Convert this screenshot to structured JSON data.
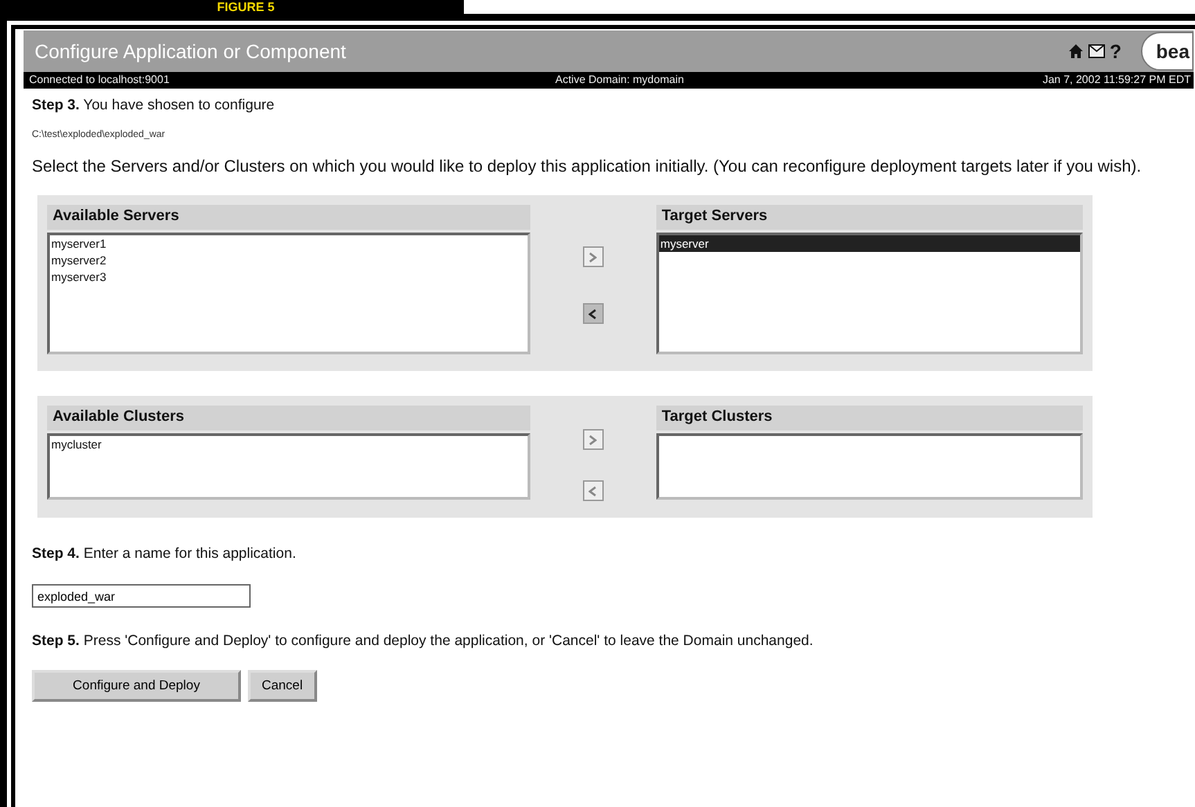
{
  "figure_label": "FIGURE 5",
  "window": {
    "title": "Configure Application or Component",
    "toolbar": [
      {
        "kind": "home"
      },
      {
        "kind": "mail"
      },
      {
        "kind": "help",
        "glyph": "?"
      }
    ],
    "logo": "bea"
  },
  "status_bar": {
    "connection": "Connected to localhost:9001",
    "domain": "Active Domain: mydomain",
    "time": "Jan 7, 2002 11:59:27 PM EDT"
  },
  "step3": {
    "text": "**Step 3.** You have shosen to configure",
    "path": "C:\\test\\exploded\\exploded_war"
  },
  "instructions": "Select the Servers and/or Clusters on which you would like to deploy this application initially. (You can reconfigure deployment targets later if you wish).",
  "panels": [
    {
      "available": {
        "heading": "Available Servers",
        "items": [
          {
            "label": "myserver1",
            "selected": false
          },
          {
            "label": "myserver2",
            "selected": false
          },
          {
            "label": "myserver3",
            "selected": false
          }
        ]
      },
      "moves": [
        {
          "kind": "add",
          "disabled": true
        },
        {
          "kind": "remove",
          "disabled": false
        }
      ],
      "target": {
        "heading": "Target Servers",
        "items": [
          {
            "label": "myserver",
            "selected": true
          }
        ]
      }
    },
    {
      "available": {
        "heading": "Available Clusters",
        "items": [
          {
            "label": "mycluster",
            "selected": false
          }
        ]
      },
      "moves": [
        {
          "kind": "add",
          "disabled": true
        },
        {
          "kind": "remove",
          "disabled": true
        }
      ],
      "target": {
        "heading": "Target Clusters"
      }
    }
  ],
  "step4": {
    "text": "**Step 4.** Enter a name for this application.",
    "name_value": "exploded_war"
  },
  "step5": {
    "text": "**Step 5.** Press 'Configure and Deploy' to configure and deploy the application, or 'Cancel' to leave the Domain unchanged."
  },
  "buttons": [
    "Configure and Deploy",
    "Cancel"
  ]
}
